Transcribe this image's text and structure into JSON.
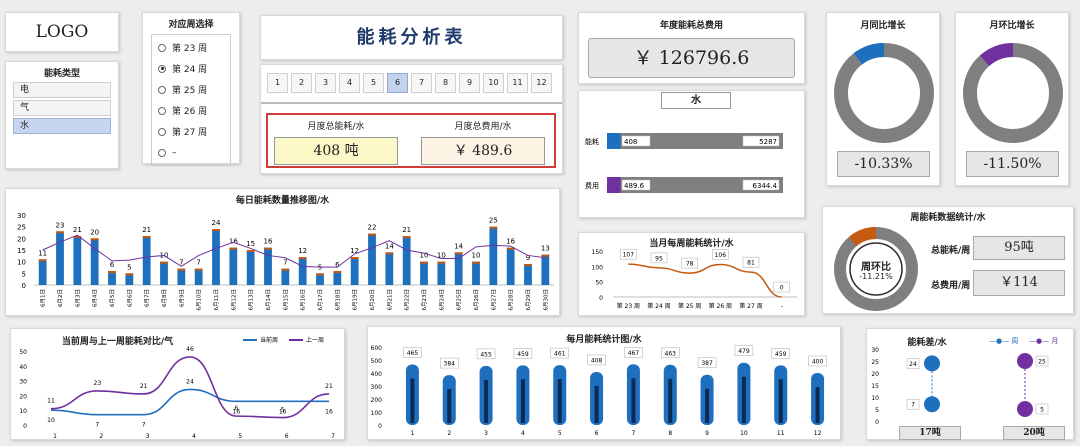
{
  "logo": "LOGO",
  "energy_type": {
    "title": "能耗类型",
    "items": [
      "电",
      "气",
      "水"
    ],
    "selected": 2
  },
  "week_select": {
    "title": "对应周选择",
    "items": [
      "第 23 周",
      "第 24 周",
      "第 25 周",
      "第 26 周",
      "第 27 周",
      "–"
    ],
    "selected": 1
  },
  "header": {
    "title": "能耗分析表"
  },
  "months": {
    "items": [
      "1",
      "2",
      "3",
      "4",
      "5",
      "6",
      "7",
      "8",
      "9",
      "10",
      "11",
      "12"
    ],
    "selected": 5
  },
  "kpi": {
    "energy_label": "月度总能耗/水",
    "energy_value": "408 吨",
    "cost_label": "月度总费用/水",
    "cost_value": "￥ 489.6"
  },
  "annual": {
    "title": "年度能耗总费用",
    "value": "￥ 126796.6",
    "sub_title": "水",
    "rows": [
      {
        "label": "能耗",
        "value": "408",
        "total": "5287",
        "frac": 0.077,
        "color": "#1f6fbf"
      },
      {
        "label": "费用",
        "value": "489.6",
        "total": "6344.4",
        "frac": 0.077,
        "color": "#7030a0"
      }
    ]
  },
  "yoy": {
    "title": "月同比增长",
    "value": "-10.33%",
    "frac": 0.1033,
    "color": "#1f6fbf"
  },
  "mom": {
    "title": "月环比增长",
    "value": "-11.50%",
    "frac": 0.115,
    "color": "#7030a0"
  },
  "weekly_stats": {
    "title": "周能耗数据统计/水",
    "ring_label": "周环比",
    "ring_value": "-11.21%",
    "frac": 0.1121,
    "energy_label": "总能耗/周",
    "energy_value": "95吨",
    "cost_label": "总费用/周",
    "cost_value": "￥114"
  },
  "daily_chart": {
    "type": "bar",
    "title": "每日能耗数量推移图/水",
    "categories": [
      "6月1日",
      "6月2日",
      "6月3日",
      "6月4日",
      "6月5日",
      "6月6日",
      "6月7日",
      "6月8日",
      "6月9日",
      "6月10日",
      "6月11日",
      "6月12日",
      "6月13日",
      "6月14日",
      "6月15日",
      "6月16日",
      "6月17日",
      "6月18日",
      "6月19日",
      "6月20日",
      "6月21日",
      "6月22日",
      "6月23日",
      "6月24日",
      "6月25日",
      "6月26日",
      "6月27日",
      "6月28日",
      "6月29日",
      "6月30日"
    ],
    "values": [
      11,
      23,
      21,
      20,
      6,
      5,
      21,
      10,
      7,
      7,
      24,
      16,
      15,
      16,
      7,
      12,
      5,
      6,
      12,
      22,
      14,
      21,
      10,
      10,
      14,
      10,
      25,
      16,
      9,
      13
    ],
    "yticks": [
      0,
      5,
      10,
      15,
      20,
      25,
      30
    ],
    "ylim": [
      0,
      30
    ],
    "color": "#1f6fbf",
    "cap_color": "#c55a11",
    "line_color": "#7030a0"
  },
  "week_trend": {
    "type": "line",
    "title": "当月每周能耗统计/水",
    "categories": [
      "第 23 周",
      "第 24 周",
      "第 25 周",
      "第 26 周",
      "第 27 周",
      "-"
    ],
    "values": [
      107,
      95,
      78,
      106,
      81,
      0
    ],
    "yticks": [
      0,
      50,
      100,
      150
    ],
    "ylim": [
      0,
      150
    ],
    "color": "#c55a11"
  },
  "compare": {
    "type": "line",
    "title": "当前周与上一周能耗对比/气",
    "categories": [
      "1",
      "2",
      "3",
      "4",
      "5",
      "6",
      "7"
    ],
    "series": [
      {
        "name": "当前周",
        "values": [
          10,
          7,
          7,
          24,
          16,
          16,
          16
        ],
        "color": "#1f6fbf"
      },
      {
        "name": "上一周",
        "values": [
          11,
          23,
          21,
          46,
          6,
          5,
          21
        ],
        "color": "#7030a0"
      }
    ],
    "ylim": [
      0,
      50
    ],
    "yticks": [
      0,
      10,
      20,
      30,
      40,
      50
    ]
  },
  "monthly": {
    "type": "bar",
    "title": "每月能耗统计图/水",
    "categories": [
      "1",
      "2",
      "3",
      "4",
      "5",
      "6",
      "7",
      "8",
      "9",
      "10",
      "11",
      "12"
    ],
    "values": [
      465,
      384,
      455,
      459,
      461,
      408,
      467,
      463,
      387,
      479,
      459,
      400
    ],
    "yticks": [
      0,
      100,
      200,
      300,
      400,
      500,
      600
    ],
    "ylim": [
      0,
      600
    ],
    "color": "#1f6fbf",
    "inner_color": "#0d2a55"
  },
  "diff": {
    "title": "能耗差/水",
    "legend_week": "—●— 周",
    "legend_month": "—●— 月",
    "yticks": [
      0,
      5,
      10,
      15,
      20,
      25,
      30
    ],
    "ylim": [
      0,
      30
    ],
    "week": {
      "high": 24,
      "low": 7,
      "label": "17吨",
      "color": "#1f6fbf"
    },
    "month": {
      "high": 25,
      "low": 5,
      "label": "20吨",
      "color": "#7030a0"
    }
  }
}
